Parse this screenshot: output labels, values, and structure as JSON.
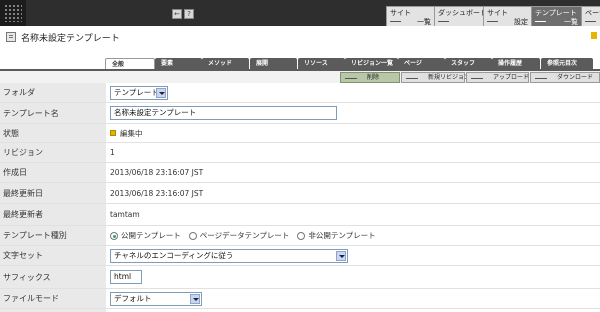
{
  "topbar": {
    "icon_buttons": [
      "←",
      "?"
    ],
    "nav": [
      {
        "line1": "サイト",
        "line2": "一覧",
        "active": false
      },
      {
        "line1": "ダッシュボード",
        "line2": "",
        "active": false
      },
      {
        "line1": "サイト",
        "line2": "設定",
        "active": false
      },
      {
        "line1": "テンプレート",
        "line2": "一覧",
        "active": true
      },
      {
        "line1": "ページ",
        "line2": "",
        "active": false
      }
    ]
  },
  "page": {
    "title": "名称未設定テンプレート"
  },
  "tabs": [
    "全般",
    "要素",
    "メソッド",
    "展開",
    "リソース",
    "リビジョン一覧",
    "ページ",
    "スタッフ",
    "操作履歴",
    "参照元目次"
  ],
  "actions": [
    "削除",
    "新規リビジョン",
    "アップロード",
    "ダウンロード"
  ],
  "form": {
    "folder": {
      "label": "フォルダ",
      "value": "テンプレート"
    },
    "template_name": {
      "label": "テンプレート名",
      "value": "名称未設定テンプレート"
    },
    "status": {
      "label": "状態",
      "value": "編集中"
    },
    "revision": {
      "label": "リビジョン",
      "value": "1"
    },
    "created": {
      "label": "作成日",
      "value": "2013/06/18 23:16:07 JST"
    },
    "updated": {
      "label": "最終更新日",
      "value": "2013/06/18 23:16:07 JST"
    },
    "updater": {
      "label": "最終更新者",
      "value": "tamtam"
    },
    "template_type": {
      "label": "テンプレート種別",
      "options": [
        "公開テンプレート",
        "ページデータテンプレート",
        "非公開テンプレート"
      ],
      "selected": 0
    },
    "charset": {
      "label": "文字セット",
      "value": "チャネルのエンコーディングに従う"
    },
    "suffix": {
      "label": "サフィックス",
      "value": "html"
    },
    "file_mode": {
      "label": "ファイルモード",
      "value": "デフォルト"
    }
  },
  "colors": {
    "topbar": "#2e2e2e",
    "tab": "#5b5b5b",
    "label_bg": "#e9e9e9",
    "status": "#e5b400"
  }
}
